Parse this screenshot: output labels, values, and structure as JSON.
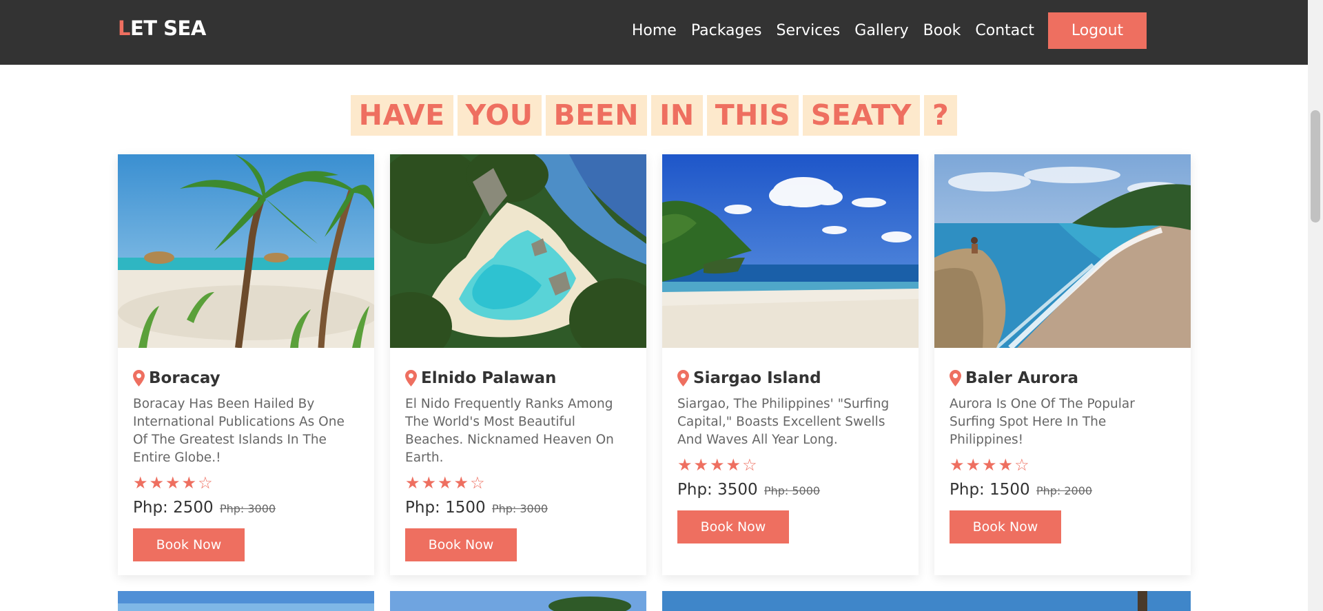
{
  "brand": {
    "first_letter": "L",
    "rest": "ET SEA"
  },
  "nav": {
    "items": [
      "Home",
      "Packages",
      "Services",
      "Gallery",
      "Book",
      "Contact"
    ],
    "logout_label": "Logout"
  },
  "heading": {
    "words": [
      "HAVE",
      "YOU",
      "BEEN",
      "IN",
      "THIS",
      "SEATY",
      "?"
    ]
  },
  "cards": [
    {
      "title": "Boracay",
      "description": "Boracay Has Been Hailed By International Publications As One Of The Greatest Islands In The Entire Globe.!",
      "rating": 4,
      "rating_max": 5,
      "price": "Php: 2500",
      "old_price": "Php: 3000",
      "button": "Book Now"
    },
    {
      "title": "Elnido Palawan",
      "description": "El Nido Frequently Ranks Among The World's Most Beautiful Beaches. Nicknamed Heaven On Earth.",
      "rating": 4,
      "rating_max": 5,
      "price": "Php: 1500",
      "old_price": "Php: 3000",
      "button": "Book Now"
    },
    {
      "title": "Siargao Island",
      "description": "Siargao, The Philippines' \"Surfing Capital,\" Boasts Excellent Swells And Waves All Year Long.",
      "rating": 4,
      "rating_max": 5,
      "price": "Php: 3500",
      "old_price": "Php: 5000",
      "button": "Book Now"
    },
    {
      "title": "Baler Aurora",
      "description": "Aurora Is One Of The Popular Surfing Spot Here In The Philippines!",
      "rating": 4,
      "rating_max": 5,
      "price": "Php: 1500",
      "old_price": "Php: 2000",
      "button": "Book Now"
    }
  ],
  "colors": {
    "accent": "#ee6f60",
    "header_bg": "#333333",
    "heading_bg": "#fde9cc"
  }
}
